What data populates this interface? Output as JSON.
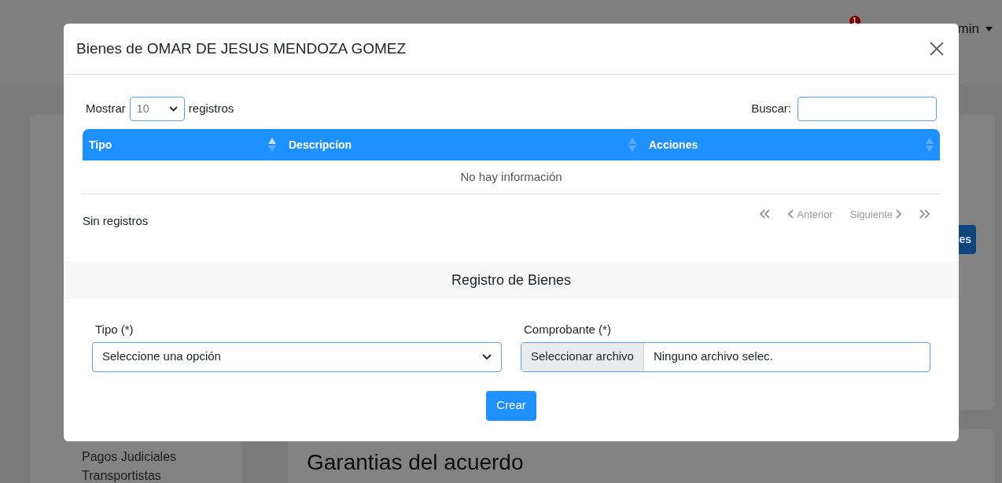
{
  "background": {
    "header": {
      "notification_count": "1",
      "user": "min"
    },
    "sidebar": {
      "items": [
        {
          "label": "Pagos Judiciales"
        },
        {
          "label": "Transportistas"
        }
      ]
    },
    "side_button": "es",
    "section_title": "Garantias del acuerdo"
  },
  "modal": {
    "title": "Bienes de OMAR DE JESUS MENDOZA GOMEZ",
    "length_menu": {
      "prefix": "Mostrar",
      "value": "10",
      "suffix": "registros"
    },
    "search": {
      "label": "Buscar:"
    },
    "table": {
      "columns": [
        {
          "label": "Tipo",
          "sorted": true
        },
        {
          "label": "Descripcíon",
          "sorted": false
        },
        {
          "label": "Acciones",
          "sorted": false
        }
      ],
      "empty_message": "No hay información"
    },
    "info": "Sin registros",
    "pagination": [
      {
        "kind": "first",
        "disabled": true
      },
      {
        "kind": "prev",
        "label": "Anterior",
        "disabled": true
      },
      {
        "kind": "next",
        "label": "Siguiente",
        "disabled": true
      },
      {
        "kind": "last",
        "disabled": true
      }
    ],
    "form": {
      "title": "Registro de Bienes",
      "fields": [
        {
          "kind": "select",
          "label": "Tipo (*)",
          "value": "Seleccione una opción"
        },
        {
          "kind": "file",
          "label": "Comprobante (*)",
          "button": "Seleccionar archivo",
          "value": "Ninguno archivo selec."
        }
      ],
      "submit": "Crear"
    }
  }
}
